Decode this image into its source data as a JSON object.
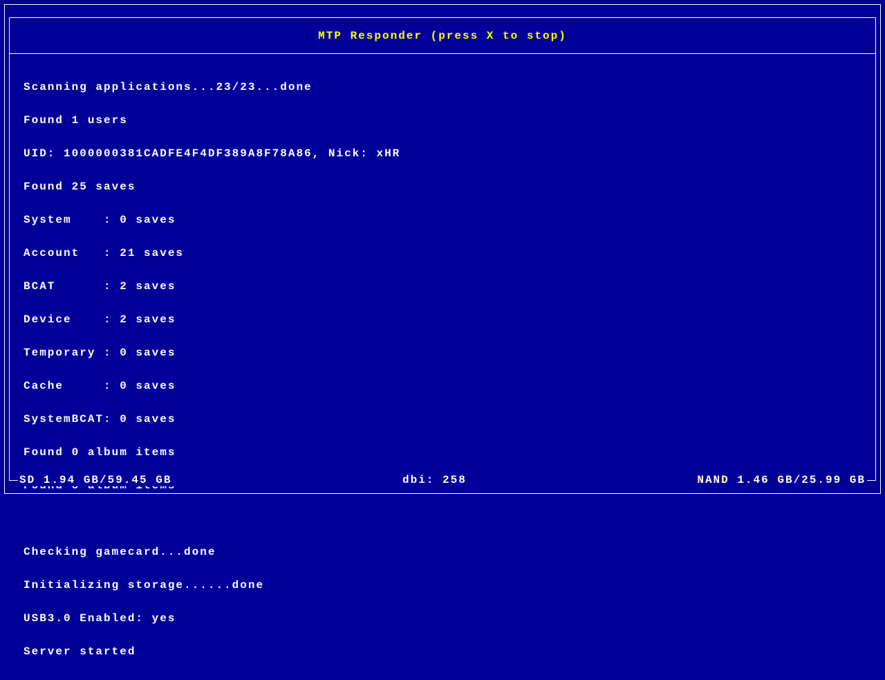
{
  "title": "MTP Responder (press X to stop)",
  "log": {
    "scan_apps": "Scanning applications...23/23...done",
    "found_users": "Found 1 users",
    "uid_line": "UID: 1000000381CADFE4F4DF389A8F78A86, Nick: xHR",
    "found_saves": "Found 25 saves",
    "system": "System    : 0 saves",
    "account": "Account   : 21 saves",
    "bcat": "BCAT      : 2 saves",
    "device": "Device    : 2 saves",
    "temporary": "Temporary : 0 saves",
    "cache": "Cache     : 0 saves",
    "systembcat": "SystemBCAT: 0 saves",
    "album0": "Found 0 album items",
    "album8": "Found 8 album items",
    "gamecard": "Checking gamecard...done",
    "storage": "Initializing storage......done",
    "usb": "USB3.0 Enabled: yes",
    "server": "Server started"
  },
  "footer": {
    "sd": "SD 1.94 GB/59.45 GB",
    "dbi": "dbi: 258",
    "nand": "NAND 1.46 GB/25.99 GB"
  }
}
